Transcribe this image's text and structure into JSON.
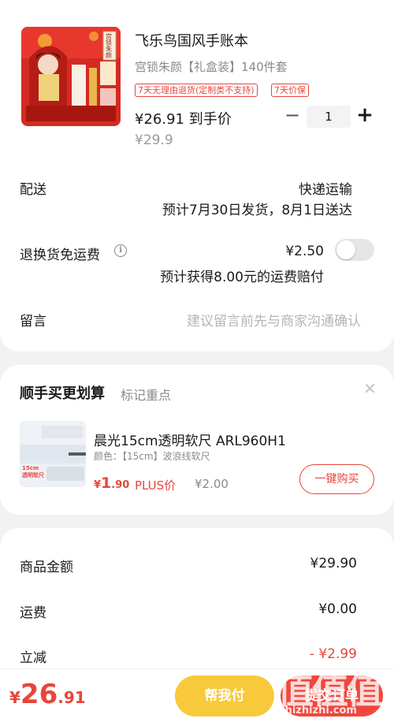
{
  "product": {
    "title": "飞乐鸟国风手账本",
    "variant": "宫锁朱颜【礼盒装】140件套",
    "tags": [
      "7天无理由退货(定制类不支持)",
      "7天价保"
    ],
    "price": "¥26.91 到手价",
    "original_price": "¥29.9",
    "quantity": "1",
    "image_text": "宫锁朱颜"
  },
  "delivery": {
    "label": "配送",
    "method": "快递运输",
    "estimate": "预计7月30日发货，8月1日送达"
  },
  "return_shipping": {
    "label": "退换货免运费",
    "price": "¥2.50",
    "note": "预计获得8.00元的运费赔付",
    "enabled": false
  },
  "message": {
    "label": "留言",
    "placeholder": "建议留言前先与商家沟通确认"
  },
  "addon": {
    "title": "顺手买更划算",
    "subtitle": "标记重点",
    "item_name": "晨光15cm透明软尺 ARL960H1",
    "item_variant": "颜色：【15cm】波浪线软尺",
    "price_symbol": "¥",
    "price_int": "1",
    "price_dec": ".90",
    "plus_label": "PLUS价",
    "regular_price": "¥2.00",
    "buy_button": "一键购买",
    "image_text": "15cm 透明软尺"
  },
  "summary": {
    "rows": [
      {
        "label": "商品金额",
        "value": "¥29.90"
      },
      {
        "label": "运费",
        "value": "¥0.00"
      },
      {
        "label": "立减",
        "value": "- ¥2.99"
      }
    ]
  },
  "bottom": {
    "currency": "¥",
    "total_int": "26",
    "total_dec": ".91",
    "help_button": "帮我付",
    "pay_button": "提交订单"
  },
  "watermark": {
    "text": "值值值",
    "url": "zhizhizhi.com"
  },
  "colors": {
    "accent_red": "#e8453c",
    "help_yellow": "#f8c93b",
    "pay_red": "#f0473d"
  }
}
